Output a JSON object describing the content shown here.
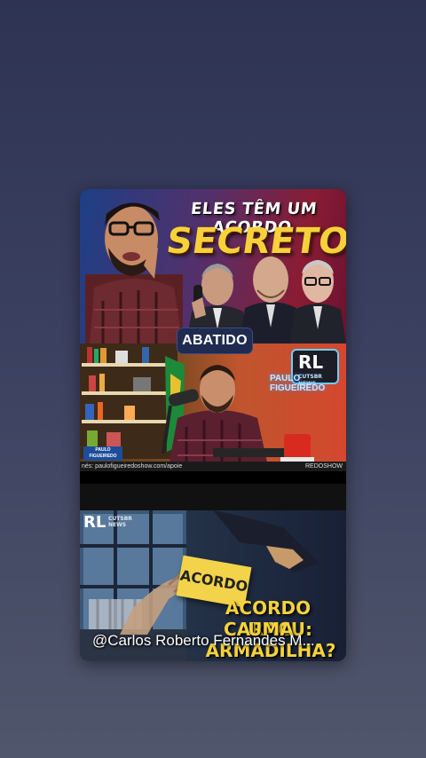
{
  "feed": {
    "panel1": {
      "headline_top": "ELES TÊM UM ACORDO",
      "headline_big": "SECRETO!"
    },
    "panel2": {
      "channel_brand_line1": "PAULO",
      "channel_brand_line2": "FIGUEIREDO",
      "logo_letters": "RL",
      "logo_sub": "CUTSBR NEWS",
      "ticker_text": "nés: paulofigueiredoshow.com/apoie",
      "ticker_right": "REDOSHOW",
      "lower_logo_line1": "PAULO",
      "lower_logo_line2": "FIGUEIREDO",
      "badge_label": "ABATIDO"
    },
    "panel3": {
      "logo_letters": "RL",
      "logo_sub1": "CUTSBR",
      "logo_sub2": "NEWS",
      "note_text": "ACORDO",
      "caption_line1": "ACORDO CARACU:",
      "caption_line2": "UMA ARMADILHA?",
      "author_handle": "@Carlos Roberto Fernandes M..."
    }
  },
  "colors": {
    "background_top": "#2e3354",
    "background_bottom": "#50566b",
    "headline_yellow": "#f6d13a",
    "badge_bg": "#1f2b4f"
  }
}
